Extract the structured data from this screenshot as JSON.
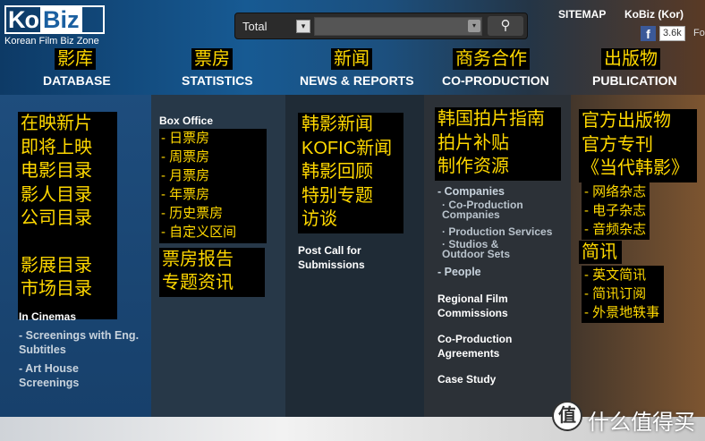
{
  "logo": {
    "ko": "Ko",
    "biz": "Biz",
    "sub": "Korean Film Biz Zone"
  },
  "search": {
    "scope": "Total",
    "dropdown_arrow": "▾",
    "button_icon": "⚲"
  },
  "toplinks": {
    "sitemap": "SITEMAP",
    "kobiz": "KoBiz (Kor)"
  },
  "facebook": {
    "icon": "f",
    "count": "3.6k",
    "extra": "Fo"
  },
  "nav": [
    {
      "cn": "影库",
      "en": "DATABASE"
    },
    {
      "cn": "票房",
      "en": "STATISTICS"
    },
    {
      "cn": "新闻",
      "en": "NEWS & REPORTS"
    },
    {
      "cn": "商务合作",
      "en": "CO-PRODUCTION"
    },
    {
      "cn": "出版物",
      "en": "PUBLICATION"
    }
  ],
  "database": {
    "cn_items_a": [
      "在映新片",
      "即将上映",
      "电影目录",
      "影人目录",
      "公司目录"
    ],
    "cn_items_b": [
      "影展目录",
      "市场目录"
    ],
    "in_cinemas": "In Cinemas",
    "screenings_eng": "- Screenings with Eng. Subtitles",
    "art_house": "- Art House Screenings"
  },
  "statistics": {
    "box_office": "Box Office",
    "cn_items": [
      "- 日票房",
      "- 周票房",
      "- 月票房",
      "- 年票房",
      "- 历史票房",
      "- 自定义区间"
    ],
    "report_items": [
      "票房报告",
      "专题资讯"
    ]
  },
  "news": {
    "cn_items": [
      "韩影新闻",
      "KOFIC新闻",
      "韩影回顾",
      "特别专题",
      "访谈"
    ],
    "post_call": "Post Call for Submissions"
  },
  "coproduction": {
    "cn_items": [
      "韩国拍片指南",
      "拍片补贴",
      "制作资源"
    ],
    "companies": "- Companies",
    "sub_items": [
      "· Co-Production Companies",
      "· Production Services",
      "· Studios & Outdoor Sets"
    ],
    "people": "- People",
    "regional": "Regional Film Commissions",
    "agreements": "Co-Production Agreements",
    "case_study": "Case Study"
  },
  "publication": {
    "cn_items": [
      "官方出版物",
      "官方专刊",
      "《当代韩影》"
    ],
    "mag_items": [
      "- 网络杂志",
      "- 电子杂志",
      "- 音频杂志"
    ],
    "newsletter": "简讯",
    "news_items": [
      "- 英文简讯",
      "- 简讯订阅",
      "- 外景地轶事"
    ]
  },
  "watermark": {
    "icon": "值",
    "text": "什么值得买"
  }
}
